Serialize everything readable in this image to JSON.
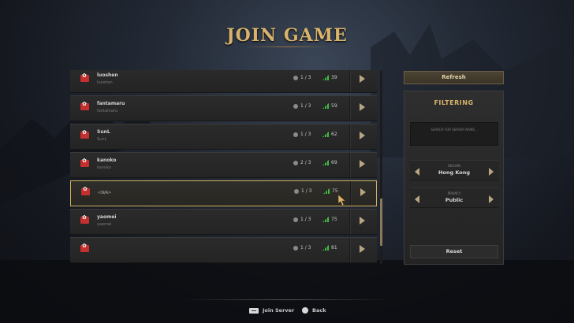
{
  "title": "JOIN GAME",
  "servers": [
    {
      "name": "luoshen",
      "host": "luoshen",
      "players": "1 / 3",
      "ping": "39",
      "region_flag": "hong-kong-flag"
    },
    {
      "name": "fantamaru",
      "host": "fantamaru",
      "players": "1 / 3",
      "ping": "59",
      "region_flag": "hong-kong-flag"
    },
    {
      "name": "SunL",
      "host": "SunL",
      "players": "1 / 3",
      "ping": "62",
      "region_flag": "hong-kong-flag"
    },
    {
      "name": "kanoko",
      "host": "kanoko",
      "players": "2 / 3",
      "ping": "69",
      "region_flag": "hong-kong-flag"
    },
    {
      "name": "",
      "host": "<N/A>",
      "players": "1 / 3",
      "ping": "75",
      "region_flag": "hong-kong-flag",
      "selected": true
    },
    {
      "name": "yaomei",
      "host": "yaomei",
      "players": "1 / 3",
      "ping": "75",
      "region_flag": "hong-kong-flag"
    },
    {
      "name": "",
      "host": "",
      "players": "1 / 3",
      "ping": "81",
      "region_flag": "hong-kong-flag"
    }
  ],
  "sidebar": {
    "refresh_label": "Refresh",
    "filter_title": "FILTERING",
    "search_placeholder": "SEARCH FOR SERVER NAME...",
    "region_label": "REGION",
    "region_value": "Hong Kong",
    "privacy_label": "PRIVACY",
    "privacy_value": "Public",
    "reset_label": "Reset"
  },
  "footer": {
    "join_label": "Join Server",
    "back_label": "Back"
  },
  "colors": {
    "accent": "#d7b36c",
    "selected_border": "#d2b160",
    "ping_green": "#3fbf3f",
    "flag_red": "#c42f2f"
  }
}
